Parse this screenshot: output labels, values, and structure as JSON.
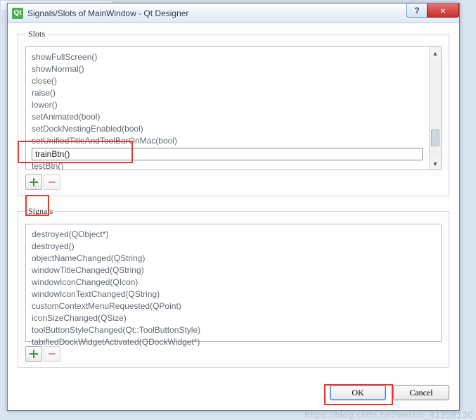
{
  "behind_tab": "…",
  "window": {
    "title": "Signals/Slots of MainWindow - Qt Designer",
    "logo_letter": "Qt",
    "help_glyph": "?",
    "close_glyph": "×"
  },
  "slots": {
    "legend": "Slots",
    "items": [
      "showFullScreen()",
      "showNormal()",
      "close()",
      "raise()",
      "lower()",
      "setAnimated(bool)",
      "setDockNestingEnabled(bool)",
      "setUnifiedTitleAndToolBarOnMac(bool)"
    ],
    "editing_value": "trainBtn()",
    "after_edit_item": "testBtn()",
    "scroll_up_glyph": "▲",
    "scroll_down_glyph": "▼"
  },
  "signals": {
    "legend": "Signals",
    "items": [
      "destroyed(QObject*)",
      "destroyed()",
      "objectNameChanged(QString)",
      "windowTitleChanged(QString)",
      "windowIconChanged(QIcon)",
      "windowIconTextChanged(QString)",
      "customContextMenuRequested(QPoint)",
      "iconSizeChanged(QSize)",
      "toolButtonStyleChanged(Qt::ToolButtonStyle)",
      "tabifiedDockWidgetActivated(QDockWidget*)"
    ]
  },
  "buttons": {
    "ok": "OK",
    "cancel": "Cancel"
  },
  "watermark": "https://blog.csdn.net/weixin_41259130"
}
